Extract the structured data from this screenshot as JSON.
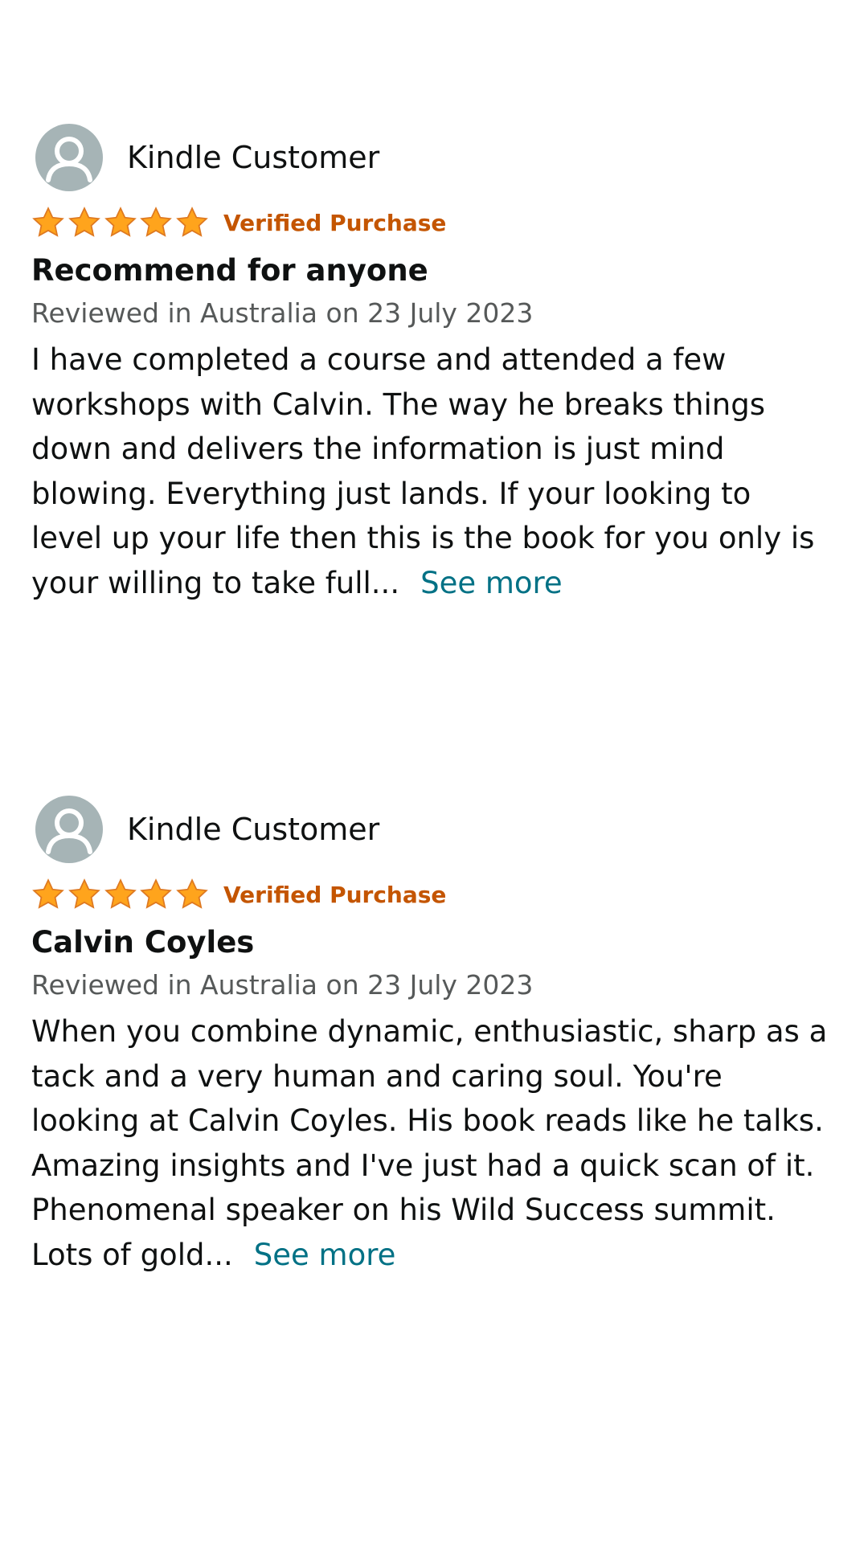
{
  "reviews": [
    {
      "reviewer": "Kindle Customer",
      "rating": 5,
      "max_rating": 5,
      "verified_label": "Verified Purchase",
      "title": "Recommend for anyone",
      "date": "Reviewed in Australia on 23 July 2023",
      "body": "I have completed a course and attended a few\nworkshops with Calvin. The way he breaks things\ndown and delivers the information is just mind\nblowing. Everything just lands. If your looking to\nlevel up your life then this is the book for you only is\nyour willing to take full...",
      "see_more_label": "See more"
    },
    {
      "reviewer": "Kindle Customer",
      "rating": 5,
      "max_rating": 5,
      "verified_label": "Verified Purchase",
      "title": "Calvin Coyles",
      "date": "Reviewed in Australia on 23 July 2023",
      "body": "When you combine dynamic, enthusiastic, sharp as a\ntack and a very human and caring soul. You're\nlooking at Calvin Coyles. His book reads like he talks.\nAmazing insights and I've just had a quick scan of it.\nPhenomenal speaker on his Wild Success summit.\nLots of gold...",
      "see_more_label": "See more"
    }
  ],
  "colors": {
    "star_fill": "#ffa41c",
    "star_stroke": "#de7921",
    "verified": "#c45500",
    "link": "#007185",
    "muted_text": "#565959",
    "avatar_bg": "#a6b4b6"
  },
  "icons": {
    "avatar": "user-avatar-icon",
    "star": "star-filled-icon"
  }
}
